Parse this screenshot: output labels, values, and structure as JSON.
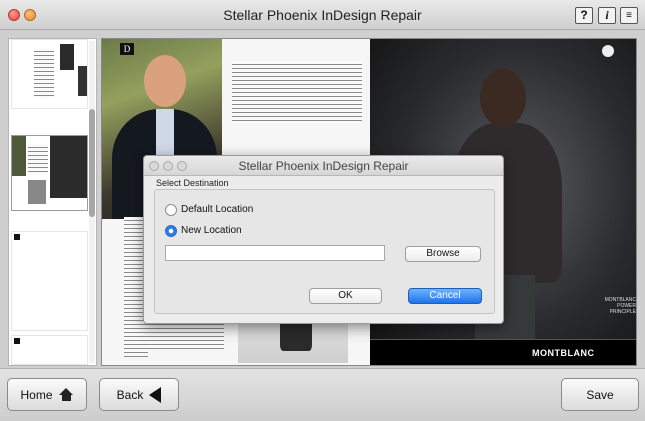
{
  "window": {
    "title": "Stellar Phoenix InDesign Repair",
    "help_label": "?",
    "info_label": "i",
    "list_label": "≡"
  },
  "preview": {
    "left_page_badge": "D",
    "right_page_brand_line1": "MONTBLANC",
    "right_page_brand_line2": "POWER PRINCIPLE",
    "right_page_logo": "MONTBLANC"
  },
  "dialog": {
    "title": "Stellar Phoenix InDesign Repair",
    "group_label": "Select Destination",
    "options": [
      {
        "label": "Default Location",
        "selected": false
      },
      {
        "label": "New Location",
        "selected": true
      }
    ],
    "path_value": "",
    "browse_label": "Browse",
    "ok_label": "OK",
    "cancel_label": "Cancel",
    "accent_color": "#1e74e8"
  },
  "bottom": {
    "home_label": "Home",
    "back_label": "Back",
    "save_label": "Save"
  }
}
